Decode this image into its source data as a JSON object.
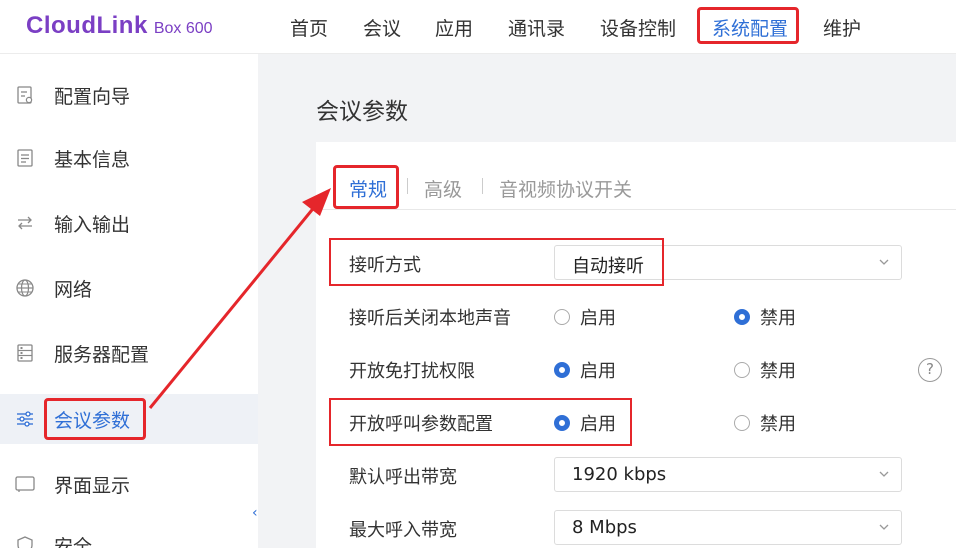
{
  "logo": {
    "main": "CloudLink",
    "sub": "Box 600"
  },
  "nav": {
    "items": [
      {
        "label": "首页"
      },
      {
        "label": "会议"
      },
      {
        "label": "应用"
      },
      {
        "label": "通讯录"
      },
      {
        "label": "设备控制"
      },
      {
        "label": "系统配置",
        "active": true
      },
      {
        "label": "维护"
      }
    ]
  },
  "sidebar": {
    "items": [
      {
        "label": "配置向导",
        "icon": "wizard-icon"
      },
      {
        "label": "基本信息",
        "icon": "document-icon"
      },
      {
        "label": "输入输出",
        "icon": "swap-icon"
      },
      {
        "label": "网络",
        "icon": "globe-icon"
      },
      {
        "label": "服务器配置",
        "icon": "server-icon"
      },
      {
        "label": "会议参数",
        "icon": "sliders-icon",
        "active": true
      },
      {
        "label": "界面显示",
        "icon": "screen-icon"
      },
      {
        "label": "安全",
        "icon": "shield-icon"
      }
    ],
    "collapse_glyph": "‹"
  },
  "page": {
    "title": "会议参数"
  },
  "tabs": [
    {
      "label": "常规",
      "active": true
    },
    {
      "label": "高级"
    },
    {
      "label": "音视频协议开关"
    }
  ],
  "form": {
    "answer_mode": {
      "label": "接听方式",
      "value": "自动接听"
    },
    "mute_local_after_answer": {
      "label": "接听后关闭本地声音",
      "enable": "启用",
      "disable": "禁用",
      "selected": "disable"
    },
    "dnd_permission": {
      "label": "开放免打扰权限",
      "enable": "启用",
      "disable": "禁用",
      "selected": "enable"
    },
    "call_param_config": {
      "label": "开放呼叫参数配置",
      "enable": "启用",
      "disable": "禁用",
      "selected": "enable"
    },
    "default_outgoing_bw": {
      "label": "默认呼出带宽",
      "value": "1920 kbps"
    },
    "max_incoming_bw": {
      "label": "最大呼入带宽",
      "value": "8 Mbps"
    }
  },
  "help_glyph": "?",
  "colors": {
    "accent": "#2f6fd6",
    "highlight": "#e5262b",
    "brand": "#7b3fc4"
  }
}
